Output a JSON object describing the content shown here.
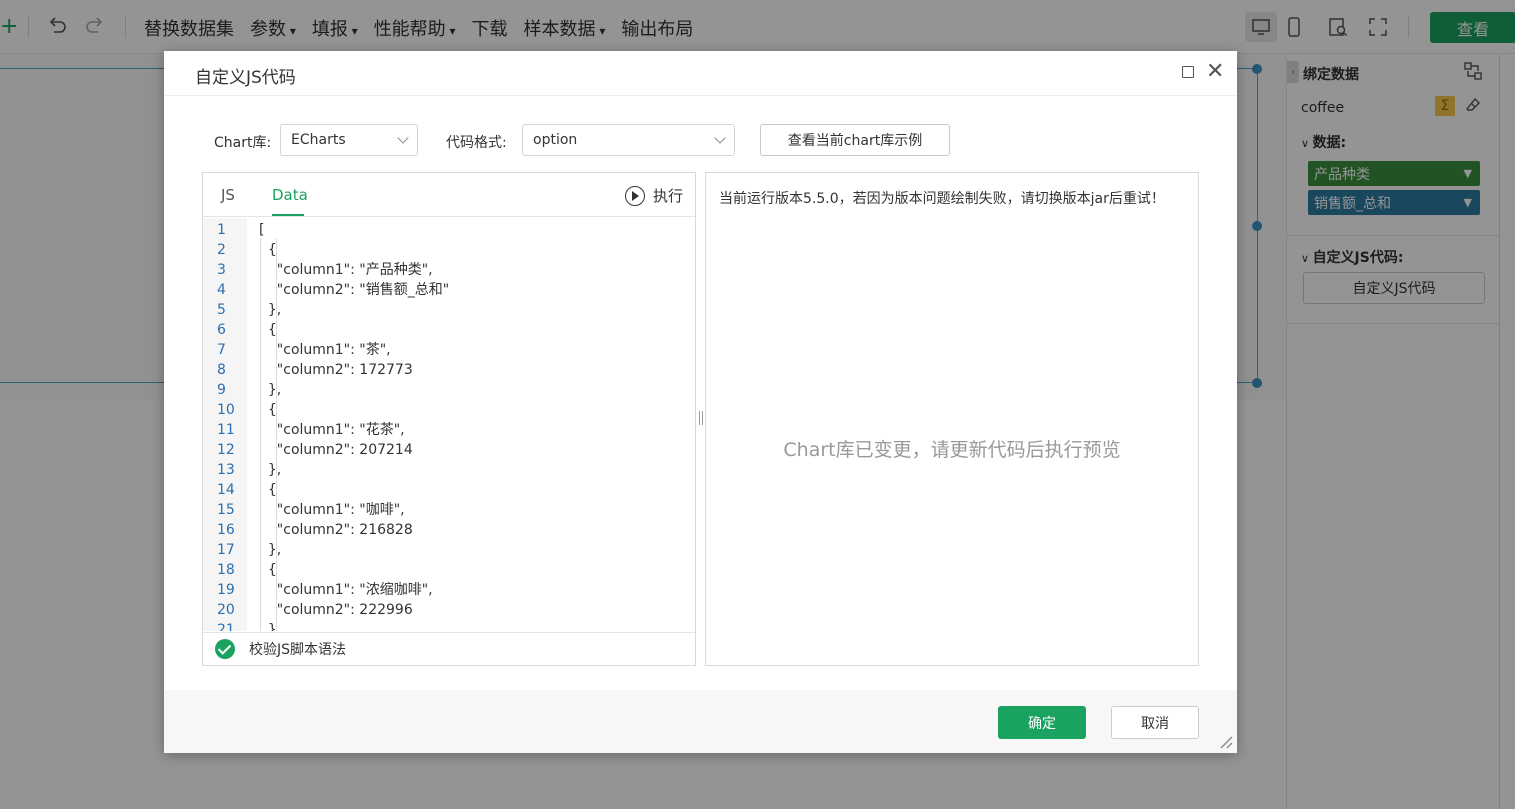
{
  "toolbar": {
    "menu": [
      "替换数据集",
      "参数",
      "填报",
      "性能帮助",
      "下载",
      "样本数据",
      "输出布局"
    ],
    "menu_has_dropdown": [
      false,
      true,
      true,
      true,
      false,
      true,
      false
    ],
    "view_button": "查看"
  },
  "right_panel": {
    "title": "绑定数据",
    "dataset": "coffee",
    "data_section": "数据:",
    "fields": [
      {
        "label": "产品种类",
        "color": "#3a8f3e"
      },
      {
        "label": "销售额_总和",
        "color": "#2c7aa3"
      }
    ],
    "custom_js_section": "自定义JS代码:",
    "custom_js_button": "自定义JS代码"
  },
  "dialog": {
    "title": "自定义JS代码",
    "chart_lib_label": "Chart库:",
    "chart_lib_value": "ECharts",
    "code_format_label": "代码格式:",
    "code_format_value": "option",
    "example_button": "查看当前chart库示例",
    "tabs": [
      "JS",
      "Data"
    ],
    "active_tab": "Data",
    "run_label": "执行",
    "code_lines": [
      "[",
      "  {",
      "    \"column1\": \"产品种类\",",
      "    \"column2\": \"销售额_总和\"",
      "  },",
      "  {",
      "    \"column1\": \"茶\",",
      "    \"column2\": 172773",
      "  },",
      "  {",
      "    \"column1\": \"花茶\",",
      "    \"column2\": 207214",
      "  },",
      "  {",
      "    \"column1\": \"咖啡\",",
      "    \"column2\": 216828",
      "  },",
      "  {",
      "    \"column1\": \"浓缩咖啡\",",
      "    \"column2\": 222996",
      "  },"
    ],
    "validate_label": "校验JS脚本语法",
    "version_message": "当前运行版本5.5.0，若因为版本问题绘制失败，请切换版本jar后重试！",
    "preview_message": "Chart库已变更，请更新代码后执行预览",
    "ok_button": "确定",
    "cancel_button": "取消"
  },
  "colors": {
    "accent": "#1aa260",
    "line_number": "#2a6fb0"
  }
}
